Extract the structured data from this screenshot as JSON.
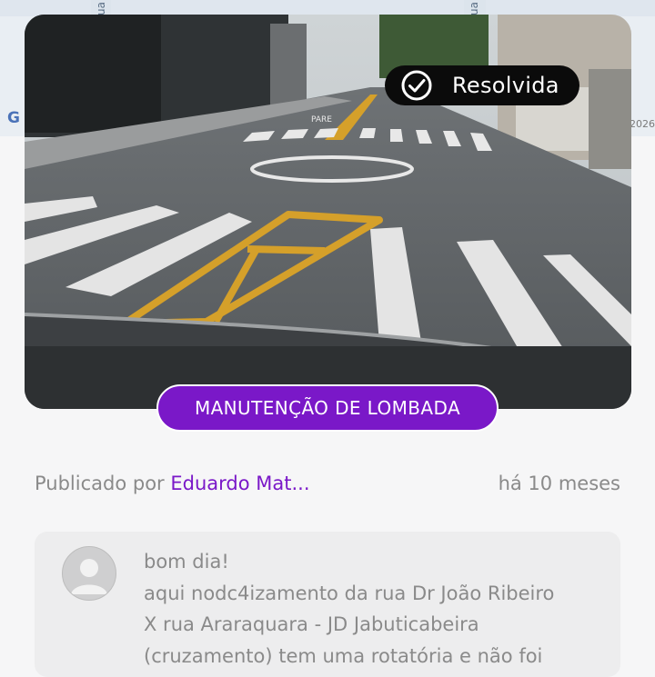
{
  "map": {
    "street_left": "Rua",
    "street_right": "Rua",
    "logo": "G",
    "year": "2026"
  },
  "photo": {
    "status_label": "Resolvida",
    "status_icon": "check-circle-icon",
    "road_marking_text": "PARE"
  },
  "category": {
    "label": "MANUTENÇÃO DE LOMBADA",
    "color": "#7a18c8"
  },
  "meta": {
    "published_prefix": "Publicado por",
    "author": "Eduardo Mat...",
    "time_ago": "há 10 meses"
  },
  "comment": {
    "avatar_icon": "user-avatar-icon",
    "lines": [
      "bom dia!",
      "aqui nodc4izamento da rua Dr João Ribeiro",
      "X rua Araraquara - JD Jabuticabeira",
      "(cruzamento) tem uma rotatória e não foi"
    ]
  }
}
